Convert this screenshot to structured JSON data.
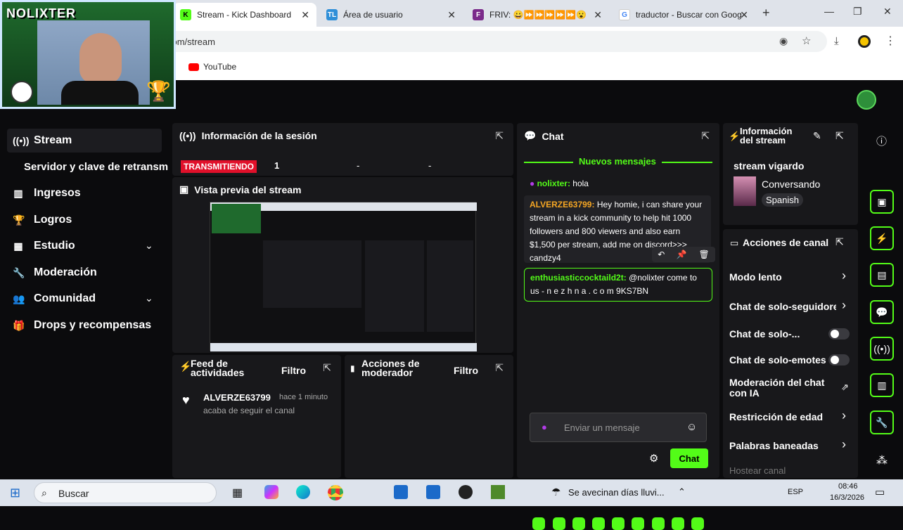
{
  "browser": {
    "tabs": [
      {
        "title": "Stream - Kick Dashboard",
        "icon": "K"
      },
      {
        "title": "Área de usuario",
        "icon": "TL"
      },
      {
        "title": "FRIV: 😀⏩⏩⏩⏩⏩😮",
        "icon": "F"
      },
      {
        "title": "traductor - Buscar con Goog",
        "icon": "G"
      }
    ],
    "url": "com/stream",
    "bookmark": "YouTube"
  },
  "overlay": {
    "logo": "NOLIXTER"
  },
  "sidebar": {
    "items": [
      {
        "label": "Stream",
        "icon": "broadcast-icon"
      },
      {
        "label": "Servidor y clave de retransm",
        "icon": ""
      },
      {
        "label": "Ingresos",
        "icon": "chart-icon"
      },
      {
        "label": "Logros",
        "icon": "trophy-icon"
      },
      {
        "label": "Estudio",
        "icon": "studio-icon"
      },
      {
        "label": "Moderación",
        "icon": "wrench-icon"
      },
      {
        "label": "Comunidad",
        "icon": "people-icon"
      },
      {
        "label": "Drops y recompensas",
        "icon": "gift-icon"
      }
    ]
  },
  "session": {
    "title": "Información de la sesión",
    "status": "TRANSMITIENDO",
    "value1": "1",
    "value2": "-",
    "value3": "-"
  },
  "preview": {
    "title": "Vista previa del stream"
  },
  "feed": {
    "title_line1": "Feed de",
    "title_line2": "actividades",
    "filter": "Filtro",
    "user": "ALVERZE63799",
    "time": "hace 1 minuto",
    "event": "acaba de seguir el canal"
  },
  "modactions": {
    "title_line1": "Acciones de",
    "title_line2": "moderador",
    "filter": "Filtro"
  },
  "chat": {
    "title": "Chat",
    "new_messages": "Nuevos mensajes",
    "messages": [
      {
        "user": "nolixter",
        "text": "hola",
        "color": "#53fc18"
      },
      {
        "user": "ALVERZE63799",
        "text": "Hey homie, i can share your stream in a kick community to help hit 1000 followers and 800 viewers and also earn $1,500 per stream, add me on discord>>> candzy4",
        "color": "#f5a623"
      },
      {
        "user": "enthusiasticcocktaild2t",
        "text": "@nolixter come to us - n e z h n a . c o m 9KS7BN",
        "color": "#53fc18"
      }
    ],
    "placeholder": "Enviar un mensaje",
    "send": "Chat"
  },
  "streaminfo": {
    "title_line1": "Información",
    "title_line2": "del stream",
    "stream_title": "stream vigardo",
    "category": "Conversando",
    "language": "Spanish"
  },
  "channel_actions": {
    "title": "Acciones de canal",
    "items": [
      "Modo lento",
      "Chat de solo-seguidore:",
      "Chat de solo-...",
      "Chat de solo-emotes",
      "Moderación del chat con IA",
      "Restricción de edad",
      "Palabras baneadas",
      "Hostear canal"
    ]
  },
  "taskbar": {
    "search": "Buscar",
    "weather": "Se avecinan días lluvi...",
    "lang": "ESP",
    "time": "08:46",
    "date": "16/3/2026"
  },
  "colors": {
    "accent": "#53fc18",
    "panel": "#18181b",
    "background": "#0b0b0d"
  }
}
